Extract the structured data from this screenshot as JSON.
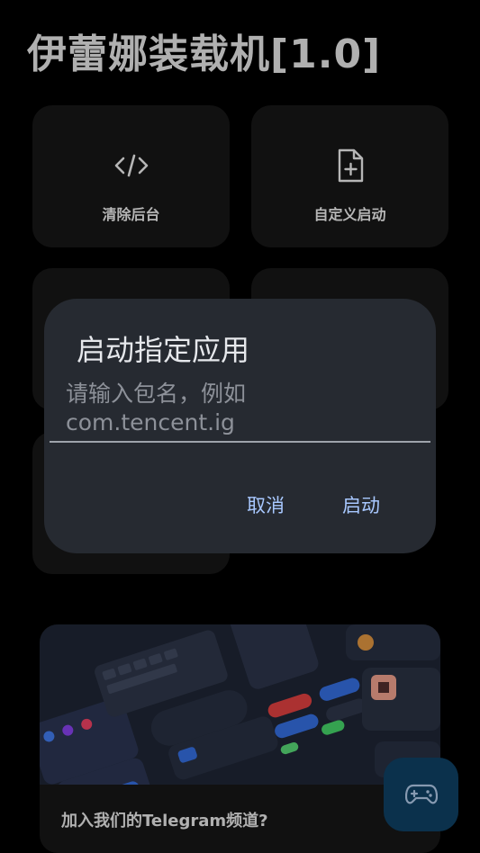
{
  "app": {
    "title": "伊蕾娜装载机[1.0]"
  },
  "tiles": [
    {
      "label": "清除后台",
      "icon": "code-icon"
    },
    {
      "label": "自定义启动",
      "icon": "file-add-icon"
    },
    {
      "label": "",
      "icon": ""
    },
    {
      "label": "",
      "icon": ""
    },
    {
      "label": "",
      "icon": ""
    }
  ],
  "promo": {
    "caption": "加入我们的Telegram频道?"
  },
  "fab": {
    "icon": "gamepad-icon"
  },
  "dialog": {
    "title": "启动指定应用",
    "input": {
      "value": "",
      "placeholder": "请输入包名，例如\ncom.tencent.ig"
    },
    "cancel_label": "取消",
    "confirm_label": "启动"
  },
  "colors": {
    "background": "#000000",
    "tile": "#141414",
    "dialog": "#262a31",
    "accent": "#a8c8ff",
    "fab": "#0d3a5a"
  }
}
